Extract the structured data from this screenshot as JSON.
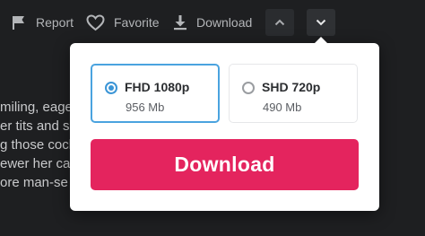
{
  "actions": {
    "report_label": "Report",
    "favorite_label": "Favorite",
    "download_label": "Download"
  },
  "description_lines": [
    "miling, eage",
    "er tits and su",
    "g those cock",
    "ewer her ca",
    "ore man-se"
  ],
  "popup": {
    "options": [
      {
        "name": "FHD 1080p",
        "size": "956 Mb",
        "selected": true
      },
      {
        "name": "SHD 720p",
        "size": "490 Mb",
        "selected": false
      }
    ],
    "download_button_label": "Download"
  },
  "icons": {
    "report": "flag-icon",
    "favorite": "heart-icon",
    "download": "download-icon",
    "up": "chevron-up-icon",
    "down": "chevron-down-icon"
  },
  "colors": {
    "page_background": "#1e1f21",
    "download_button": "#e4245e",
    "selected_border": "#4aa3df"
  }
}
